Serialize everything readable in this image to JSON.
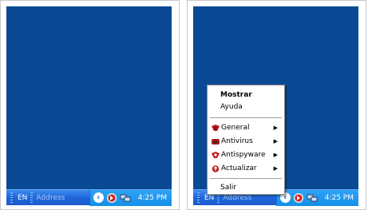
{
  "left_panel": {
    "taskbar": {
      "language": "EN",
      "address_label": "Address",
      "clock": "4:25 PM"
    }
  },
  "right_panel": {
    "taskbar": {
      "language": "EN",
      "address_label": "Address",
      "clock": "4:25 PM"
    },
    "context_menu": {
      "items": [
        {
          "label": "Mostrar",
          "bold": true
        },
        {
          "label": "Ayuda"
        },
        {
          "label": "General",
          "icon": "shield-icon",
          "submenu": true
        },
        {
          "label": "Antivirus",
          "icon": "shield-icon",
          "submenu": true
        },
        {
          "label": "Antispyware",
          "icon": "shield-icon",
          "submenu": true
        },
        {
          "label": "Actualizar",
          "icon": "update-icon",
          "submenu": true
        },
        {
          "label": "Salir"
        }
      ]
    }
  },
  "colors": {
    "desktop": "#0a4a94",
    "taskbar": "#1e64d8",
    "tray": "#1490e8"
  }
}
